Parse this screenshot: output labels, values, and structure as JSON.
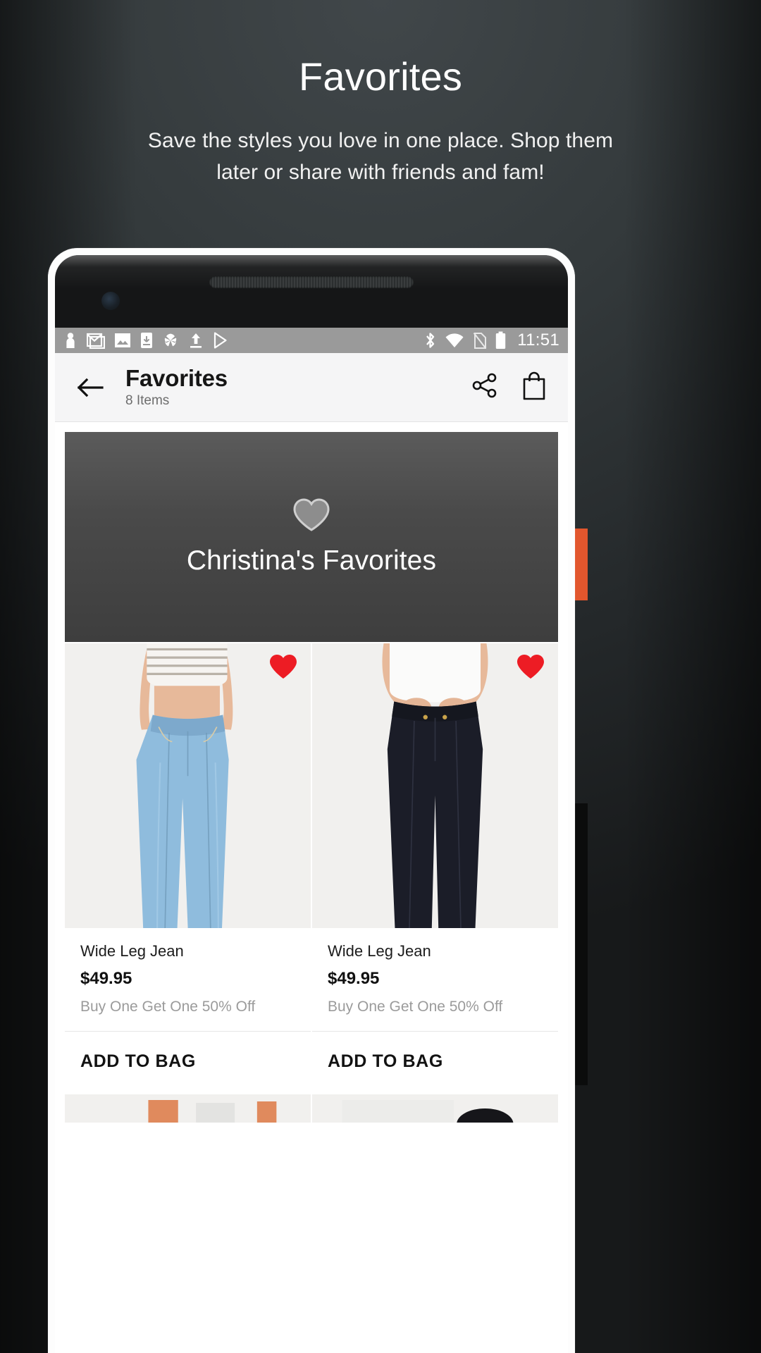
{
  "promo": {
    "title": "Favorites",
    "subtitle": "Save the styles you love in one place. Shop them later or share with friends and fam!"
  },
  "status_bar": {
    "time": "11:51",
    "left_icons": [
      "contact-icon",
      "gmail-icon",
      "photos-icon",
      "download-icon",
      "pinwheel-icon",
      "upload-icon",
      "play-store-icon"
    ],
    "right_icons": [
      "bluetooth-icon",
      "wifi-icon",
      "sim-off-icon",
      "battery-icon"
    ],
    "background": "#9a9a9a"
  },
  "app_bar": {
    "back_label": "back-arrow",
    "title": "Favorites",
    "subtitle": "8 Items",
    "share_label": "share-icon",
    "bag_label": "shopping-bag-icon"
  },
  "hero": {
    "icon": "heart-outline-icon",
    "title": "Christina's Favorites"
  },
  "products": [
    {
      "name": "Wide Leg Jean",
      "price": "$49.95",
      "promo": "Buy One Get One 50% Off",
      "cta": "ADD TO BAG",
      "favorited": true,
      "wash": "light"
    },
    {
      "name": "Wide Leg Jean",
      "price": "$49.95",
      "promo": "Buy One Get One 50% Off",
      "cta": "ADD TO BAG",
      "favorited": true,
      "wash": "dark"
    }
  ],
  "colors": {
    "accent_orange": "#e2562d",
    "heart_red": "#ed1c24",
    "status_bar_gray": "#9a9a9a",
    "hero_gray": "#4a4a4a"
  }
}
